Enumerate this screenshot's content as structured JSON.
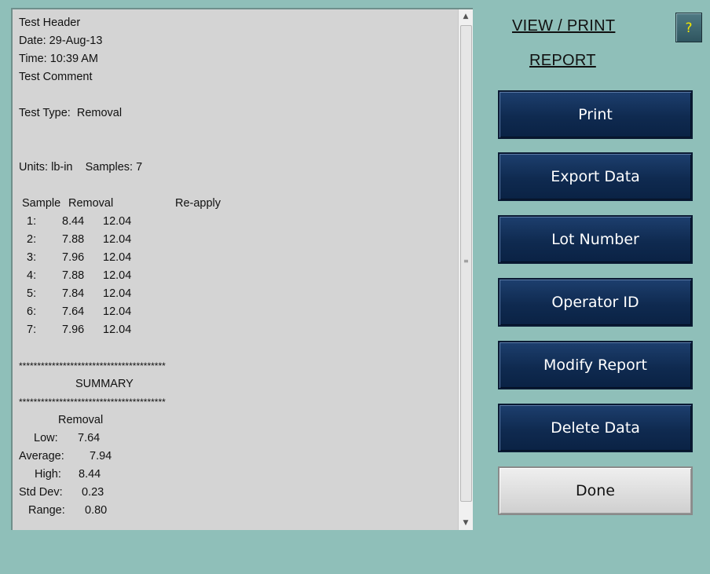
{
  "report": {
    "header": "Test Header",
    "date": "Date: 29-Aug-13",
    "time": "Time: 10:39 AM",
    "comment": "Test Comment",
    "test_type": "Test Type:  Removal",
    "units_samples": "Units: lb-in    Samples: 7",
    "columns": {
      "sample": "Sample",
      "removal": "Removal",
      "reapply": "Re-apply"
    },
    "rows": [
      {
        "num": "1:",
        "removal": "8.44",
        "reapply": "12.04"
      },
      {
        "num": "2:",
        "removal": "7.88",
        "reapply": "12.04"
      },
      {
        "num": "3:",
        "removal": "7.96",
        "reapply": "12.04"
      },
      {
        "num": "4:",
        "removal": "7.88",
        "reapply": "12.04"
      },
      {
        "num": "5:",
        "removal": "7.84",
        "reapply": "12.04"
      },
      {
        "num": "6:",
        "removal": "7.64",
        "reapply": "12.04"
      },
      {
        "num": "7:",
        "removal": "7.96",
        "reapply": "12.04"
      }
    ],
    "stars": "****************************************",
    "summary_label": "SUMMARY",
    "summary_column": "Removal",
    "summary": [
      {
        "label": "Low:",
        "value": "7.64"
      },
      {
        "label": "Average:",
        "value": "7.94"
      },
      {
        "label": "High:",
        "value": "8.44"
      },
      {
        "label": "Std Dev:",
        "value": "0.23"
      },
      {
        "label": "Range:",
        "value": "0.80"
      }
    ]
  },
  "scrollbar": {
    "up_icon": "triangle-up",
    "down_icon": "triangle-down",
    "grip_icon": "grip-lines"
  },
  "side": {
    "title_line1": "VIEW / PRINT",
    "title_line2": "REPORT",
    "help_label": "?",
    "buttons": {
      "print": "Print",
      "export": "Export Data",
      "lot": "Lot Number",
      "operator": "Operator ID",
      "modify": "Modify Report",
      "delete": "Delete Data",
      "done": "Done"
    }
  },
  "colors": {
    "background": "#8fbfb9",
    "report_bg": "#d4d4d4",
    "button_navy": "#0f2a50",
    "help_text": "#f2e600"
  }
}
